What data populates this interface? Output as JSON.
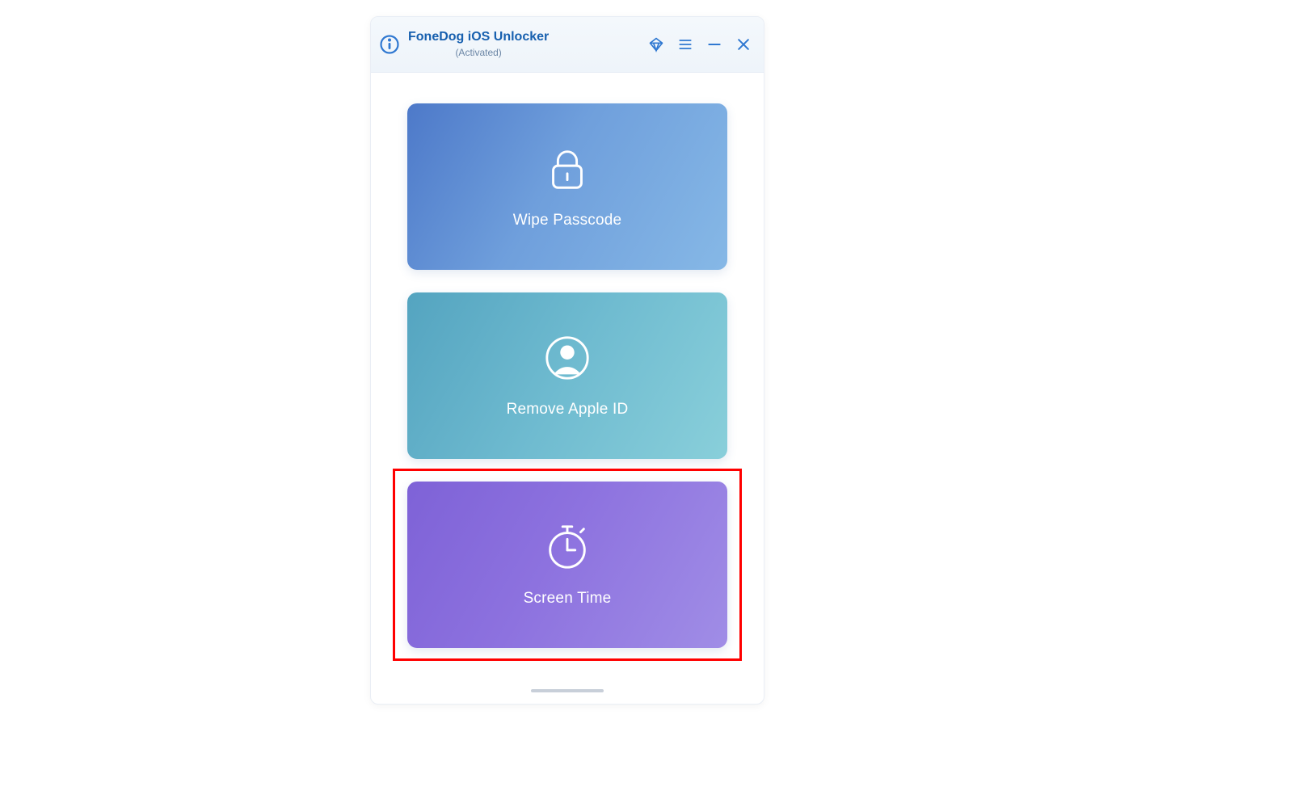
{
  "app": {
    "title": "FoneDog iOS Unlocker",
    "subtitle": "(Activated)"
  },
  "cards": {
    "wipe_passcode": {
      "label": "Wipe Passcode"
    },
    "remove_apple_id": {
      "label": "Remove Apple ID"
    },
    "screen_time": {
      "label": "Screen Time"
    }
  }
}
